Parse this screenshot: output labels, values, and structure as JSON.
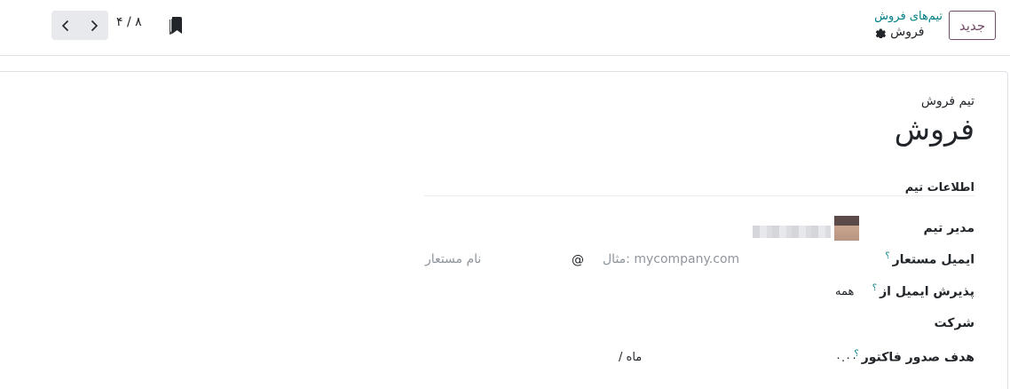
{
  "control_panel": {
    "new_button": "جدید",
    "breadcrumb_parent": "تیم‌های فروش",
    "breadcrumb_current": "فروش",
    "pager_counter": "۴ / ۸"
  },
  "form": {
    "team_label": "تیم فروش",
    "team_name": "فروش",
    "group_title": "اطلاعات تیم",
    "fields": {
      "manager_label": "مدیر تیم",
      "alias_label": "ایمیل مستعار",
      "alias_help": "؟",
      "alias_placeholder": "نام مستعار",
      "at_sign": "@",
      "domain_placeholder": "مثال: mycompany.com",
      "accept_label": "پذیرش ایمیل از",
      "accept_help": "؟",
      "accept_value": "همه",
      "company_label": "شرکت",
      "invoice_label": "هدف صدور فاکتور",
      "invoice_help": "؟",
      "invoice_value": "۰.۰۰",
      "invoice_unit": "/ ماه"
    }
  },
  "icons": [
    "gear-icon",
    "chevron-left-icon",
    "chevron-right-icon",
    "bookmark-icon",
    "avatar"
  ],
  "colors": {
    "brand": "#714B67",
    "link": "#017e84"
  }
}
